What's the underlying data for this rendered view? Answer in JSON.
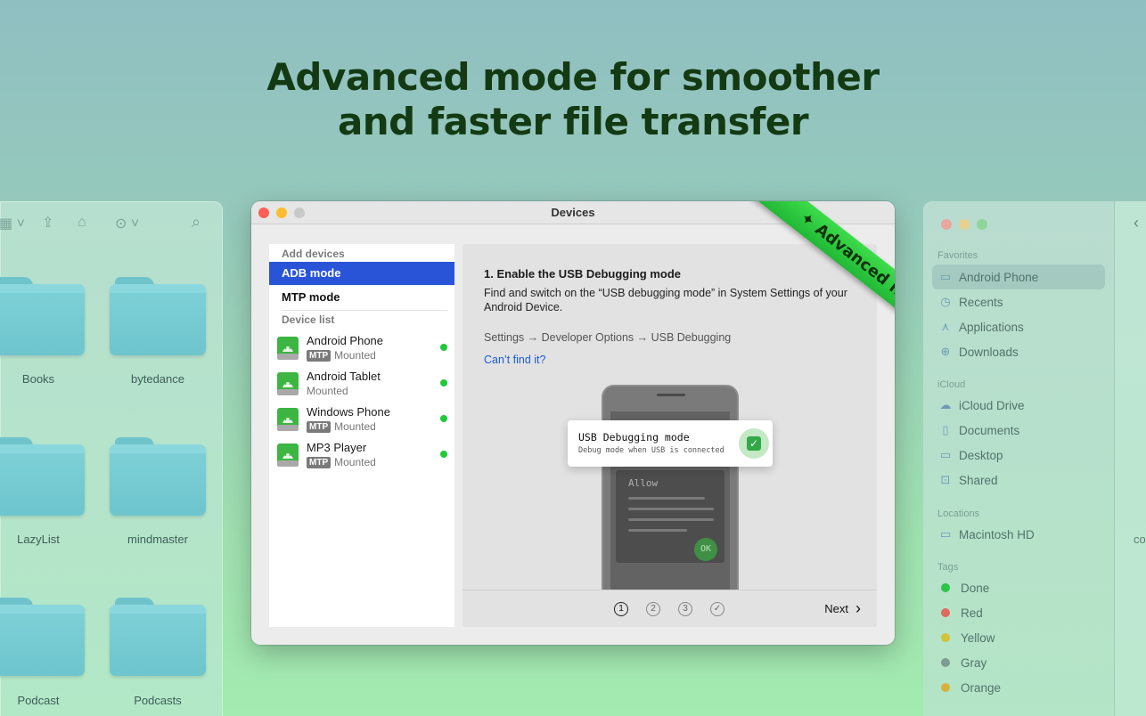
{
  "hero": {
    "line1": "Advanced mode for smoother",
    "line2": "and faster file transfer"
  },
  "left_finder": {
    "folders": [
      "Books",
      "bytedance",
      "LazyList",
      "mindmaster",
      "Podcast",
      "Podcasts"
    ]
  },
  "window": {
    "title": "Devices",
    "ribbon": "Advanced mode",
    "sidebar": {
      "add_devices_header": "Add devices",
      "modes": [
        "ADB mode",
        "MTP mode"
      ],
      "device_list_header": "Device list",
      "devices": [
        {
          "name": "Android Phone",
          "badge": "MTP",
          "status": "Mounted"
        },
        {
          "name": "Android Tablet",
          "badge": "",
          "status": "Mounted"
        },
        {
          "name": "Windows Phone",
          "badge": "MTP",
          "status": "Mounted"
        },
        {
          "name": "MP3 Player",
          "badge": "MTP",
          "status": "Mounted"
        }
      ]
    },
    "panel": {
      "title": "1. Enable the USB Debugging mode",
      "description": "Find and switch on the “USB debugging mode” in System Settings of your Android Device.",
      "path": "Settings → Developer Options → USB Debugging",
      "link": "Can’t find it?",
      "popup_title": "USB Debugging mode",
      "popup_subtitle": "Debug mode when USB is connected",
      "allow": "Allow",
      "ok": "OK",
      "steps": [
        "1",
        "2",
        "3",
        "✓"
      ],
      "next": "Next"
    }
  },
  "right_finder": {
    "favorites_header": "Favorites",
    "favorites": [
      "Android Phone",
      "Recents",
      "Applications",
      "Downloads"
    ],
    "icloud_header": "iCloud",
    "icloud": [
      "iCloud Drive",
      "Documents",
      "Desktop",
      "Shared"
    ],
    "locations_header": "Locations",
    "locations": [
      "Macintosh HD"
    ],
    "tags_header": "Tags",
    "tags": [
      {
        "name": "Done",
        "color": "#2fc34a"
      },
      {
        "name": "Red",
        "color": "#e06a5c"
      },
      {
        "name": "Yellow",
        "color": "#d3c23a"
      },
      {
        "name": "Gray",
        "color": "#7f9c90"
      },
      {
        "name": "Orange",
        "color": "#d7b13e"
      }
    ],
    "partial_label": "co"
  },
  "colors": {
    "accent_blue": "#2a54d8",
    "status_green": "#1fc93a",
    "ribbon_green": "#2ac43c"
  }
}
